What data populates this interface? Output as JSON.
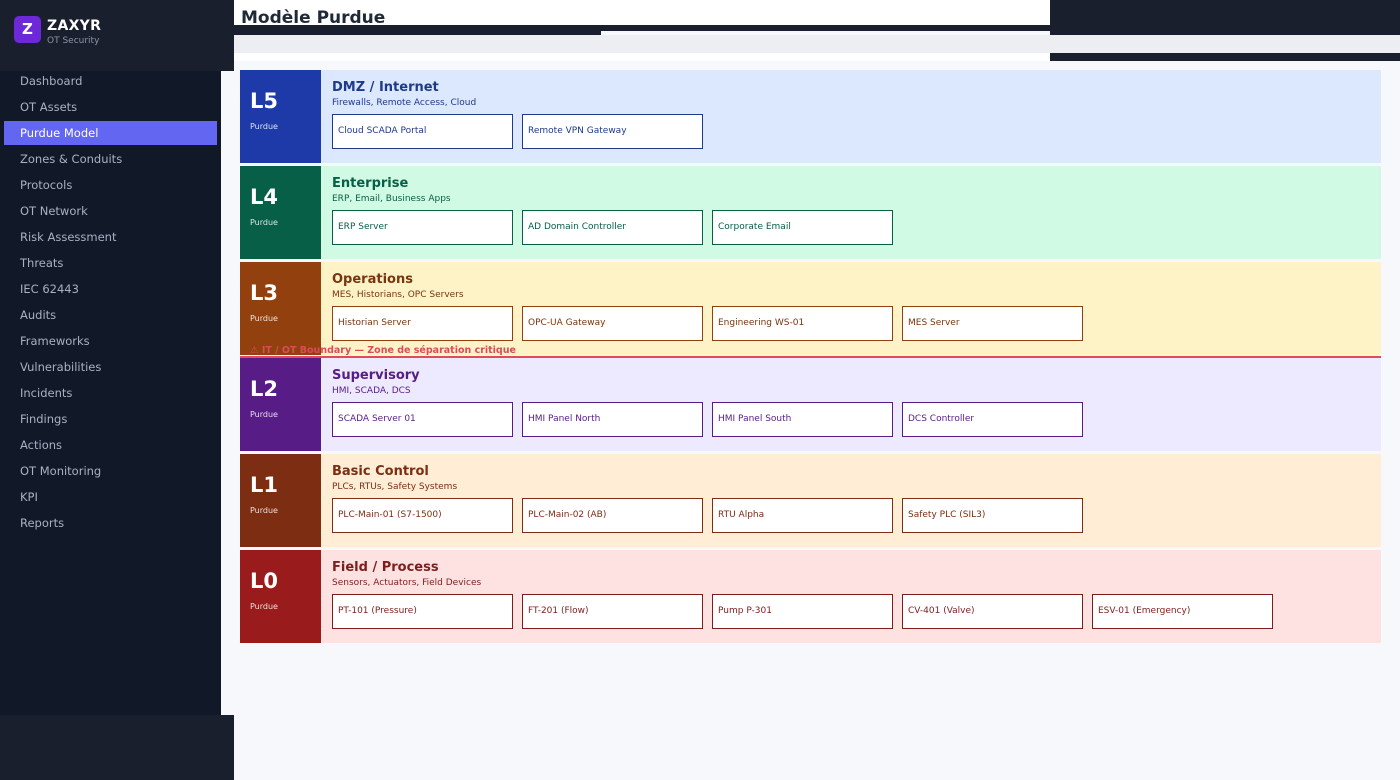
{
  "app": {
    "logo_letter": "Z",
    "name": "ZAXYR",
    "subtitle": "OT Security"
  },
  "page": {
    "title": "Modèle Purdue"
  },
  "sidebar": {
    "items": [
      {
        "label": "Dashboard",
        "active": false
      },
      {
        "label": "OT Assets",
        "active": false
      },
      {
        "label": "Purdue Model",
        "active": true
      },
      {
        "label": "Zones & Conduits",
        "active": false
      },
      {
        "label": "Protocols",
        "active": false
      },
      {
        "label": "OT Network",
        "active": false
      },
      {
        "label": "Risk Assessment",
        "active": false
      },
      {
        "label": "Threats",
        "active": false
      },
      {
        "label": "IEC 62443",
        "active": false
      },
      {
        "label": "Audits",
        "active": false
      },
      {
        "label": "Frameworks",
        "active": false
      },
      {
        "label": "Vulnerabilities",
        "active": false
      },
      {
        "label": "Incidents",
        "active": false
      },
      {
        "label": "Findings",
        "active": false
      },
      {
        "label": "Actions",
        "active": false
      },
      {
        "label": "OT Monitoring",
        "active": false
      },
      {
        "label": "KPI",
        "active": false
      },
      {
        "label": "Reports",
        "active": false
      }
    ]
  },
  "purdue": {
    "boundary_label": "⚠ IT / OT Boundary — Zone de séparation critique",
    "levels": [
      {
        "code": "L5",
        "tag": "Purdue",
        "title": "DMZ / Internet",
        "desc": "Firewalls, Remote Access, Cloud",
        "colors": {
          "tag": "#1e3aa8",
          "bg": "#dbe8fd",
          "text": "#1e3a8a",
          "border": "#1e3a8a"
        },
        "assets": [
          "Cloud SCADA Portal",
          "Remote VPN Gateway"
        ]
      },
      {
        "code": "L4",
        "tag": "Purdue",
        "title": "Enterprise",
        "desc": "ERP, Email, Business Apps",
        "colors": {
          "tag": "#065f46",
          "bg": "#d1fae5",
          "text": "#065f46",
          "border": "#065f46"
        },
        "assets": [
          "ERP Server",
          "AD Domain Controller",
          "Corporate Email"
        ]
      },
      {
        "code": "L3",
        "tag": "Purdue",
        "title": "Operations",
        "desc": "MES, Historians, OPC Servers",
        "colors": {
          "tag": "#92400e",
          "bg": "#fef3c7",
          "text": "#78350f",
          "border": "#92400e"
        },
        "assets": [
          "Historian Server",
          "OPC-UA Gateway",
          "Engineering WS-01",
          "MES Server"
        ]
      },
      {
        "code": "L2",
        "tag": "Purdue",
        "title": "Supervisory",
        "desc": "HMI, SCADA, DCS",
        "colors": {
          "tag": "#581c87",
          "bg": "#ede9fe",
          "text": "#581c87",
          "border": "#581c87"
        },
        "assets": [
          "SCADA Server 01",
          "HMI Panel North",
          "HMI Panel South",
          "DCS Controller"
        ]
      },
      {
        "code": "L1",
        "tag": "Purdue",
        "title": "Basic Control",
        "desc": "PLCs, RTUs, Safety Systems",
        "colors": {
          "tag": "#7c2d12",
          "bg": "#ffedd5",
          "text": "#7c2d12",
          "border": "#7c2d12"
        },
        "assets": [
          "PLC-Main-01 (S7-1500)",
          "PLC-Main-02 (AB)",
          "RTU Alpha",
          "Safety PLC (SIL3)"
        ]
      },
      {
        "code": "L0",
        "tag": "Purdue",
        "title": "Field / Process",
        "desc": "Sensors, Actuators, Field Devices",
        "colors": {
          "tag": "#991b1b",
          "bg": "#fee2e2",
          "text": "#7f1d1d",
          "border": "#7f1d1d"
        },
        "assets": [
          "PT-101 (Pressure)",
          "FT-201 (Flow)",
          "Pump P-301",
          "CV-401 (Valve)",
          "ESV-01 (Emergency)"
        ]
      }
    ]
  }
}
